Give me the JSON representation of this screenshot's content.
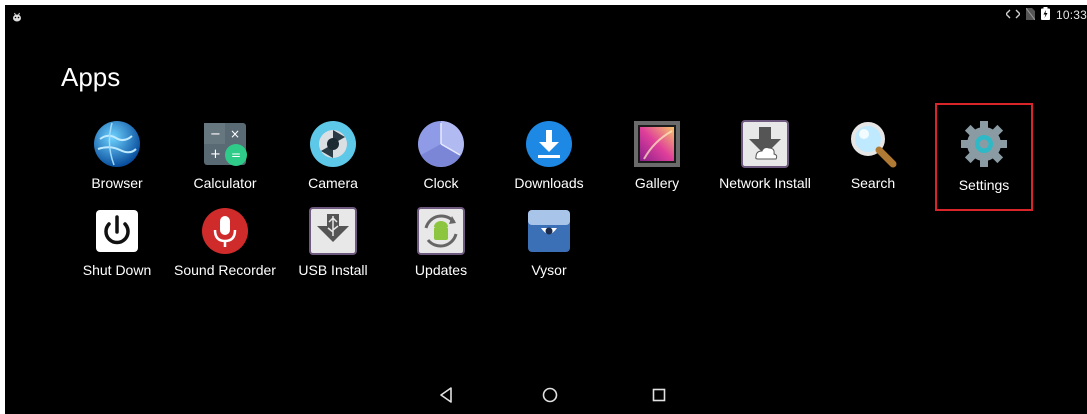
{
  "screen_title": "Apps",
  "status_bar": {
    "time": "10:33",
    "icons": [
      "android-debug-icon",
      "code-arrows-icon",
      "no-sim-icon",
      "battery-charging-icon"
    ]
  },
  "apps": [
    {
      "label": "Browser",
      "icon": "globe-icon"
    },
    {
      "label": "Calculator",
      "icon": "calculator-icon"
    },
    {
      "label": "Camera",
      "icon": "camera-aperture-icon"
    },
    {
      "label": "Clock",
      "icon": "clock-icon"
    },
    {
      "label": "Downloads",
      "icon": "download-arrow-icon"
    },
    {
      "label": "Gallery",
      "icon": "gallery-photo-icon"
    },
    {
      "label": "Network Install",
      "icon": "cloud-download-icon"
    },
    {
      "label": "Search",
      "icon": "magnifier-icon"
    },
    {
      "label": "Settings",
      "icon": "gear-icon",
      "selected": true
    },
    {
      "label": "Shut Down",
      "icon": "power-icon"
    },
    {
      "label": "Sound Recorder",
      "icon": "microphone-icon"
    },
    {
      "label": "USB Install",
      "icon": "usb-install-icon"
    },
    {
      "label": "Updates",
      "icon": "android-update-icon"
    },
    {
      "label": "Vysor",
      "icon": "vysor-icon"
    }
  ],
  "navigation": {
    "back": "back-icon",
    "home": "home-icon",
    "recents": "recents-icon"
  },
  "colors": {
    "background": "#000000",
    "selection": "#d9252a",
    "text": "#ffffff"
  }
}
